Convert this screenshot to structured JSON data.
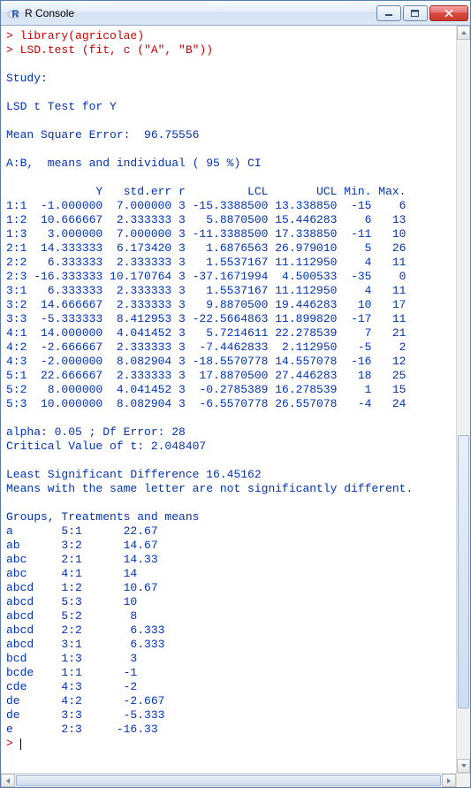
{
  "window": {
    "title": "R Console"
  },
  "commands": [
    "library(agricolae)",
    "LSD.test (fit, c (\"A\", \"B\"))"
  ],
  "output": {
    "study_label": "Study:",
    "test_label": "LSD t Test for Y",
    "mse_label": "Mean Square Error:  96.75556",
    "ci_label": "A:B,  means and individual ( 95 %) CI",
    "table_header": "             Y   std.err r         LCL       UCL Min. Max.",
    "table_rows": [
      "1:1  -1.000000  7.000000 3 -15.3388500 13.338850  -15    6",
      "1:2  10.666667  2.333333 3   5.8870500 15.446283    6   13",
      "1:3   3.000000  7.000000 3 -11.3388500 17.338850  -11   10",
      "2:1  14.333333  6.173420 3   1.6876563 26.979010    5   26",
      "2:2   6.333333  2.333333 3   1.5537167 11.112950    4   11",
      "2:3 -16.333333 10.170764 3 -37.1671994  4.500533  -35    0",
      "3:1   6.333333  2.333333 3   1.5537167 11.112950    4   11",
      "3:2  14.666667  2.333333 3   9.8870500 19.446283   10   17",
      "3:3  -5.333333  8.412953 3 -22.5664863 11.899820  -17   11",
      "4:1  14.000000  4.041452 3   5.7214611 22.278539    7   21",
      "4:2  -2.666667  2.333333 3  -7.4462833  2.112950   -5    2",
      "4:3  -2.000000  8.082904 3 -18.5570778 14.557078  -16   12",
      "5:1  22.666667  2.333333 3  17.8870500 27.446283   18   25",
      "5:2   8.000000  4.041452 3  -0.2785389 16.278539    1   15",
      "5:3  10.000000  8.082904 3  -6.5570778 26.557078   -4   24"
    ],
    "alpha_line": "alpha: 0.05 ; Df Error: 28",
    "critval_line": "Critical Value of t: 2.048407",
    "lsd_line": "Least Significant Difference 16.45162",
    "letters_note": "Means with the same letter are not significantly different.",
    "groups_header": "Groups, Treatments and means",
    "group_rows": [
      "a       5:1      22.67",
      "ab      3:2      14.67",
      "abc     2:1      14.33",
      "abc     4:1      14",
      "abcd    1:2      10.67",
      "abcd    5:3      10",
      "abcd    5:2       8",
      "abcd    2:2       6.333",
      "abcd    3:1       6.333",
      "bcd     1:3       3",
      "bcde    1:1      -1",
      "cde     4:3      -2",
      "de      4:2      -2.667",
      "de      3:3      -5.333",
      "e       2:3     -16.33"
    ]
  },
  "colors": {
    "command": "#c80000",
    "output": "#0033b3"
  }
}
